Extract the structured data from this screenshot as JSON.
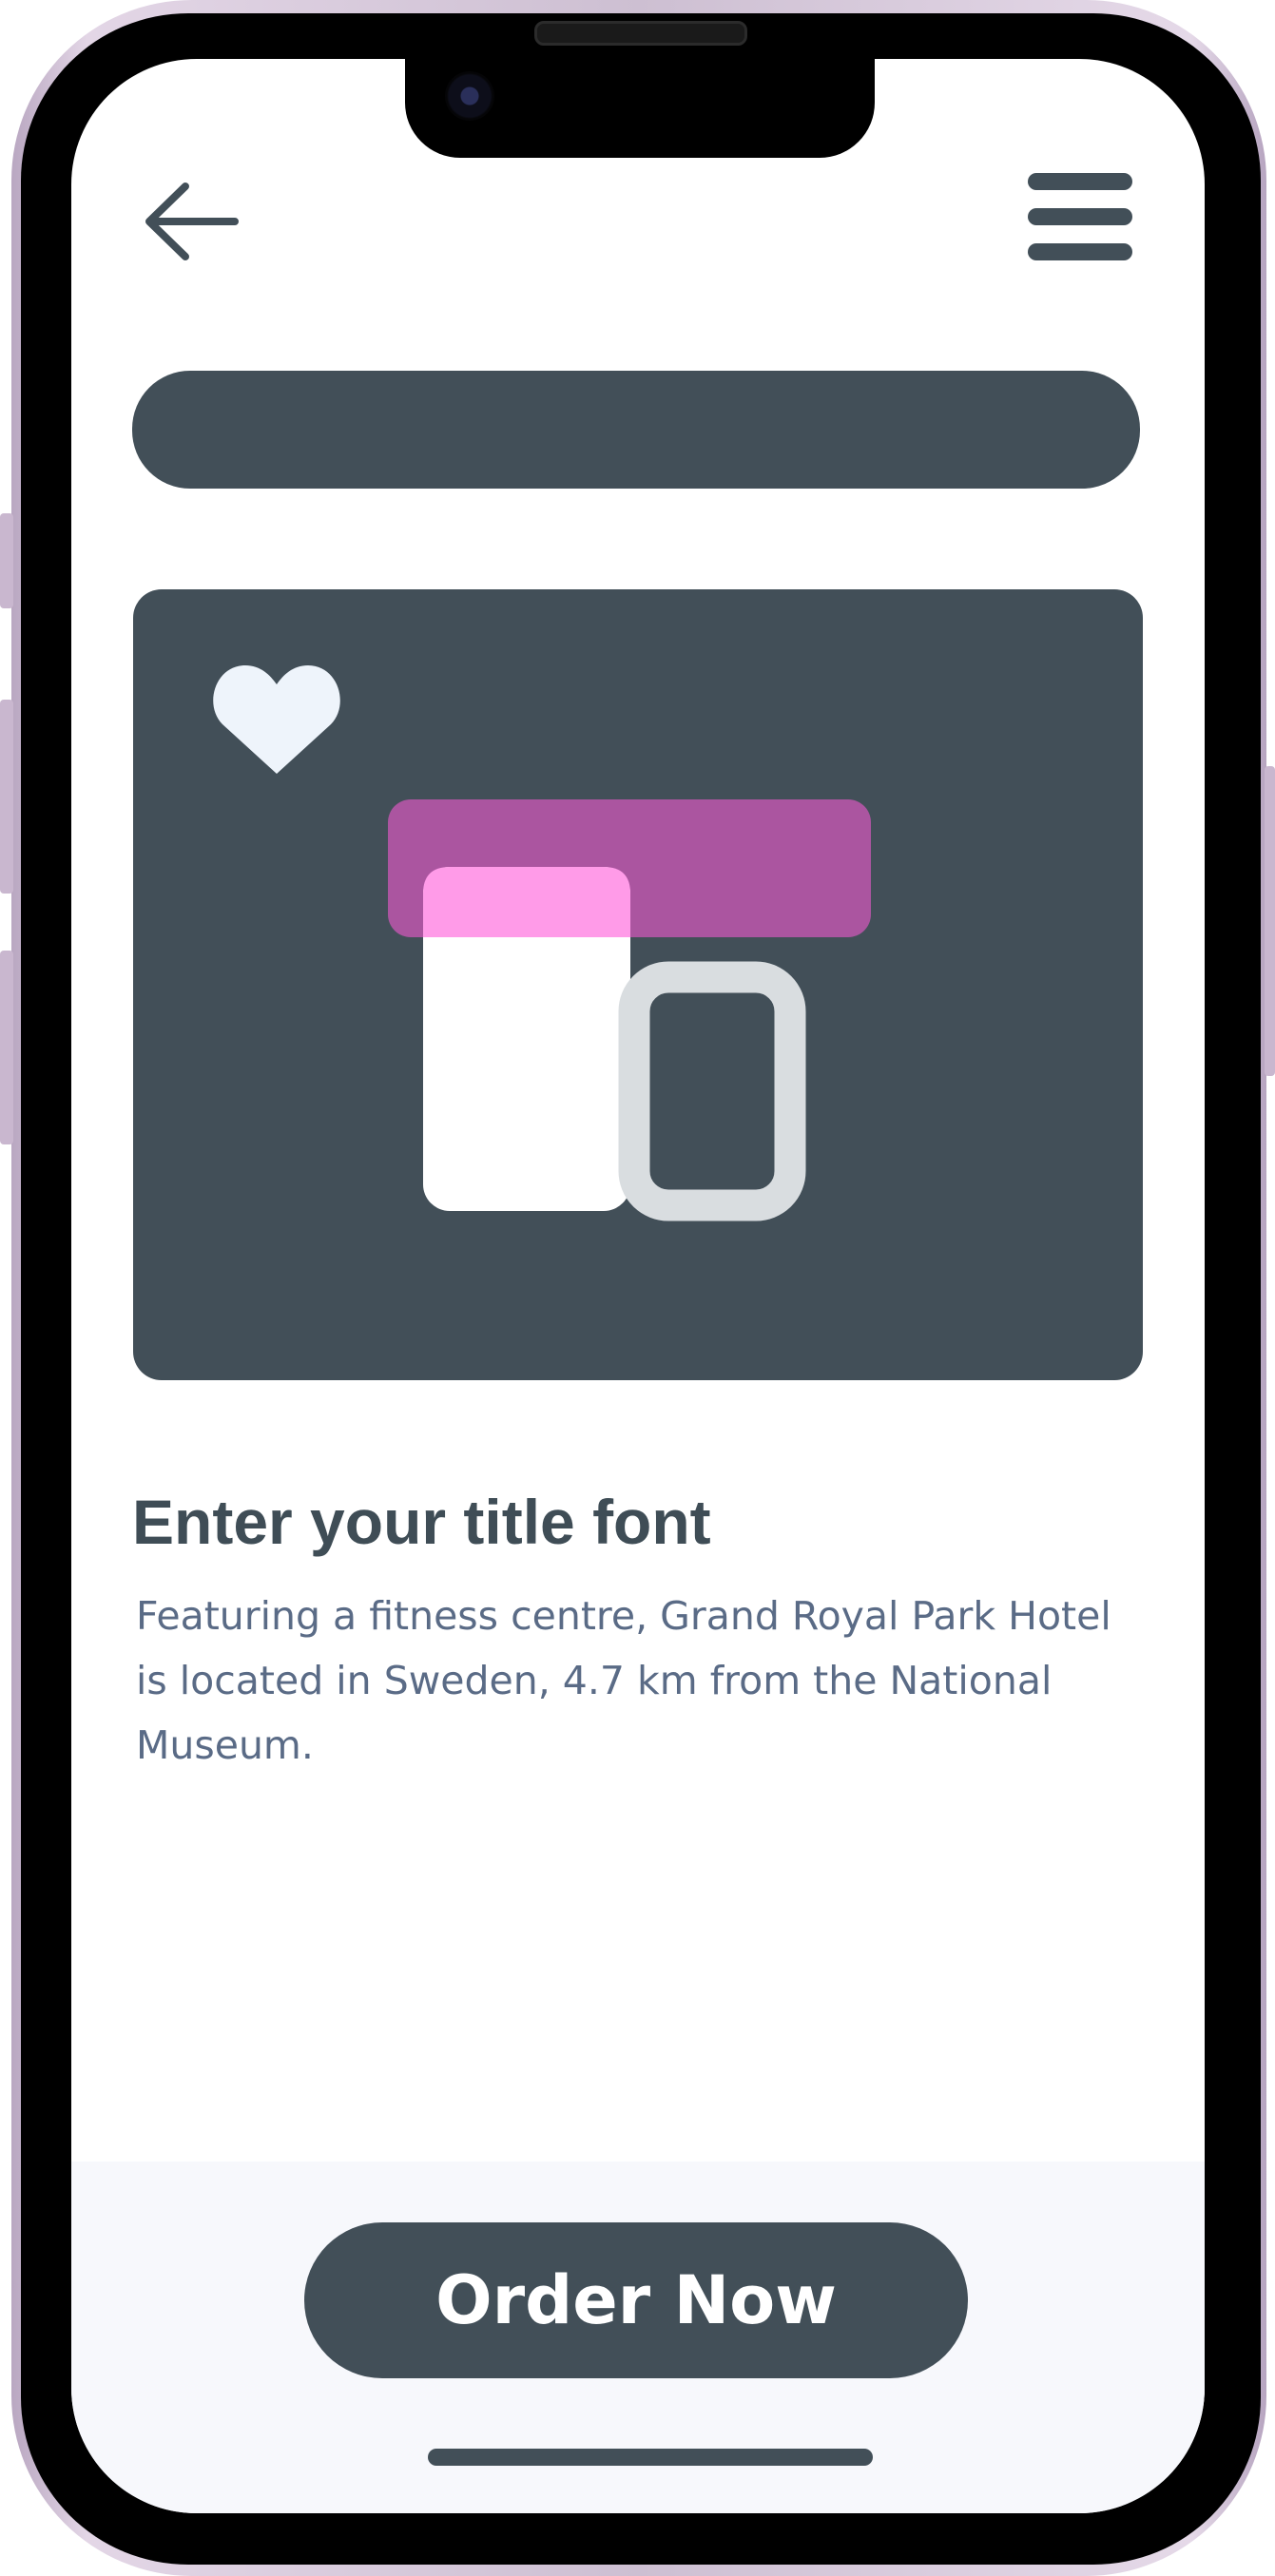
{
  "theme": {
    "primary": "#424f58",
    "accent_magenta": "#ab55a0",
    "accent_pink": "#ff9be8",
    "heart": "#eef4fb",
    "text_body": "#5a6b86",
    "footer_bg": "#f7f8fc",
    "frame": "#cdbfd2"
  },
  "header": {
    "back_icon": "arrow-left-icon",
    "menu_icon": "hamburger-menu-icon"
  },
  "search": {
    "placeholder": ""
  },
  "card": {
    "favorite_icon": "heart-icon",
    "illustration": "layout-illustration"
  },
  "content": {
    "title": "Enter your title font",
    "description": "Featuring a fitness centre, Grand Royal Park Hotel is located in Sweden, 4.7 km from the National Museum."
  },
  "footer": {
    "order_label": "Order Now"
  }
}
